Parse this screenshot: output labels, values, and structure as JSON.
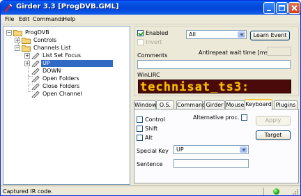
{
  "window": {
    "title": "Girder 3.3 [ProgDVB.GML]",
    "menu": [
      "File",
      "Edit",
      "Commands",
      "Help"
    ]
  },
  "tree": {
    "items": [
      {
        "label": "ProgDVB",
        "icon": "folder-icon"
      },
      {
        "label": "Controls",
        "icon": "folder-icon"
      },
      {
        "label": "Channels List",
        "icon": "folder-icon"
      },
      {
        "label": "List Set Focus",
        "icon": "command-icon"
      },
      {
        "label": "UP",
        "icon": "command-icon",
        "selected": true
      },
      {
        "label": "DOWN",
        "icon": "command-icon"
      },
      {
        "label": "Open Folders",
        "icon": "command-icon"
      },
      {
        "label": "Close Folders",
        "icon": "command-icon"
      },
      {
        "label": "Open Channel",
        "icon": "command-icon"
      }
    ]
  },
  "event": {
    "enabled_label": "Enabled",
    "enabled": true,
    "invert_label": "Invert",
    "invert": false,
    "device_value": "All",
    "learn_button": "Learn Event",
    "comments_label": "Comments",
    "comments_value": "",
    "antirepeat_label": "Antirepeat wait time [ms]",
    "antirepeat_value": "",
    "winlirc_label": "WinLIRC",
    "winlirc_display": "technisat_ts3:"
  },
  "tabs": [
    "Window",
    "O.S.",
    "Command",
    "Girder",
    "Mouse",
    "Keyboard",
    "Plugins"
  ],
  "active_tab": "Keyboard",
  "keyboard": {
    "control_label": "Control",
    "shift_label": "Shift",
    "alt_label": "Alt",
    "alternative_label": "Alternative proc.",
    "apply_button": "Apply",
    "target_button": "Target",
    "special_key_label": "Special Key",
    "special_key_value": "UP",
    "sentence_label": "Sentence",
    "sentence_value": ""
  },
  "status": {
    "text": "Captured IR code.",
    "indicator_color": "#1aa514"
  }
}
